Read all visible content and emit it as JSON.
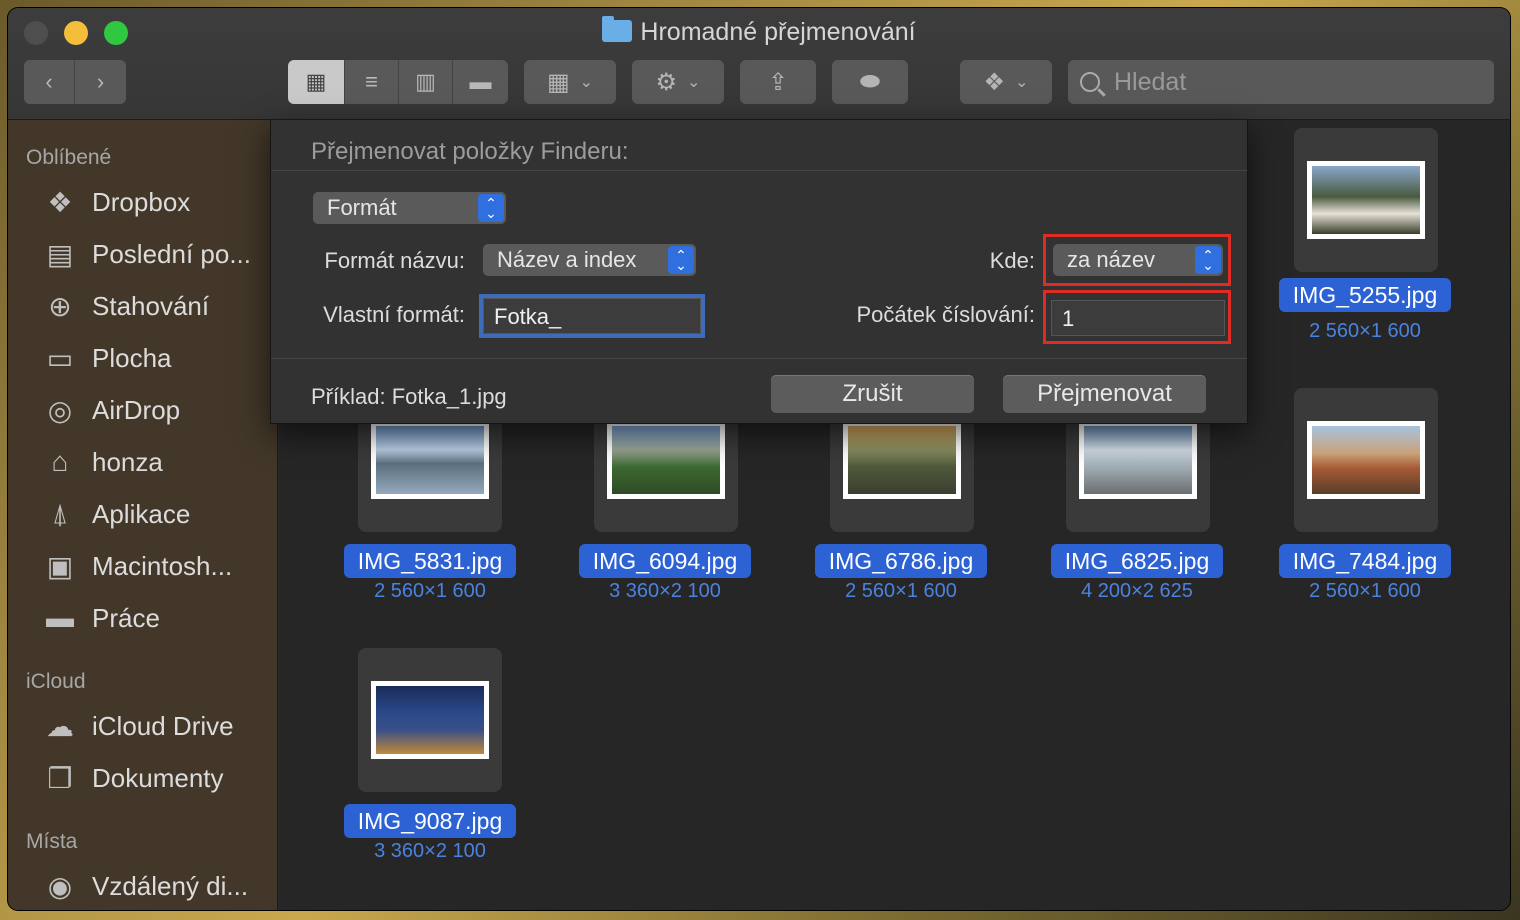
{
  "window": {
    "title": "Hromadné přejmenování"
  },
  "toolbar": {
    "search_placeholder": "Hledat"
  },
  "sidebar": {
    "sections": [
      {
        "title": "Oblíbené"
      },
      {
        "title": "iCloud"
      },
      {
        "title": "Místa"
      }
    ],
    "favorites": [
      "Dropbox",
      "Poslední po...",
      "Stahování",
      "Plocha",
      "AirDrop",
      "honza",
      "Aplikace",
      "Macintosh...",
      "Práce"
    ],
    "icloud": [
      "iCloud Drive",
      "Dokumenty"
    ],
    "places": [
      "Vzdálený di..."
    ]
  },
  "dialog": {
    "title": "Přejmenovat položky Finderu:",
    "mode": "Formát",
    "name_format_label": "Formát názvu:",
    "name_format_value": "Název a index",
    "where_label": "Kde:",
    "where_value": "za název",
    "custom_format_label": "Vlastní formát:",
    "custom_format_value": "Fotka_",
    "start_label": "Počátek číslování:",
    "start_value": "1",
    "example": "Příklad: Fotka_1.jpg",
    "cancel": "Zrušit",
    "rename": "Přejmenovat"
  },
  "files": [
    {
      "name": "IMG_5255.jpg",
      "dims": "2 560×1 600"
    },
    {
      "name": "IMG_5831.jpg",
      "dims": "2 560×1 600"
    },
    {
      "name": "IMG_6094.jpg",
      "dims": "3 360×2 100"
    },
    {
      "name": "IMG_6786.jpg",
      "dims": "2 560×1 600"
    },
    {
      "name": "IMG_6825.jpg",
      "dims": "4 200×2 625"
    },
    {
      "name": "IMG_7484.jpg",
      "dims": "2 560×1 600"
    },
    {
      "name": "IMG_9087.jpg",
      "dims": "3 360×2 100"
    }
  ]
}
